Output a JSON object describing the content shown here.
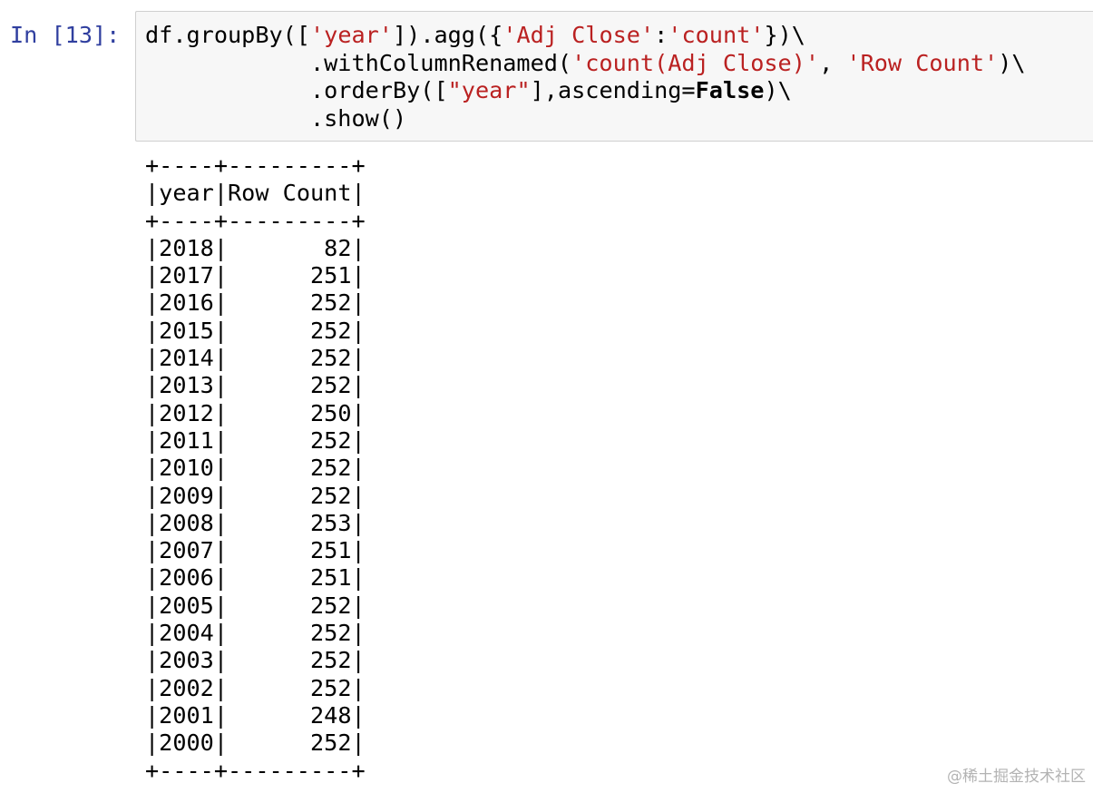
{
  "cell": {
    "prompt": "In [13]:",
    "code_lines": [
      [
        {
          "t": "df.groupBy([",
          "c": "plain"
        },
        {
          "t": "'year'",
          "c": "str"
        },
        {
          "t": "]).agg({",
          "c": "plain"
        },
        {
          "t": "'Adj Close'",
          "c": "str"
        },
        {
          "t": ":",
          "c": "plain"
        },
        {
          "t": "'count'",
          "c": "str"
        },
        {
          "t": "})\\",
          "c": "plain"
        }
      ],
      [
        {
          "t": "            .withColumnRenamed(",
          "c": "plain"
        },
        {
          "t": "'count(Adj Close)'",
          "c": "str"
        },
        {
          "t": ", ",
          "c": "plain"
        },
        {
          "t": "'Row Count'",
          "c": "str"
        },
        {
          "t": ")\\",
          "c": "plain"
        }
      ],
      [
        {
          "t": "            .orderBy([",
          "c": "plain"
        },
        {
          "t": "\"year\"",
          "c": "str"
        },
        {
          "t": "],ascending=",
          "c": "plain"
        },
        {
          "t": "False",
          "c": "kw"
        },
        {
          "t": ")\\",
          "c": "plain"
        }
      ],
      [
        {
          "t": "            .show()",
          "c": "plain"
        }
      ]
    ]
  },
  "output": {
    "border": "+----+---------+",
    "headers": [
      "year",
      "Row Count"
    ],
    "rows": [
      [
        "2018",
        "82"
      ],
      [
        "2017",
        "251"
      ],
      [
        "2016",
        "252"
      ],
      [
        "2015",
        "252"
      ],
      [
        "2014",
        "252"
      ],
      [
        "2013",
        "252"
      ],
      [
        "2012",
        "250"
      ],
      [
        "2011",
        "252"
      ],
      [
        "2010",
        "252"
      ],
      [
        "2009",
        "252"
      ],
      [
        "2008",
        "253"
      ],
      [
        "2007",
        "251"
      ],
      [
        "2006",
        "251"
      ],
      [
        "2005",
        "252"
      ],
      [
        "2004",
        "252"
      ],
      [
        "2003",
        "252"
      ],
      [
        "2002",
        "252"
      ],
      [
        "2001",
        "248"
      ],
      [
        "2000",
        "252"
      ]
    ]
  },
  "watermark": "@稀土掘金技术社区",
  "colors": {
    "prompt": "#303f9f",
    "string": "#ba2121",
    "cell_background": "#f7f7f7",
    "cell_border": "#cfcfcf"
  }
}
